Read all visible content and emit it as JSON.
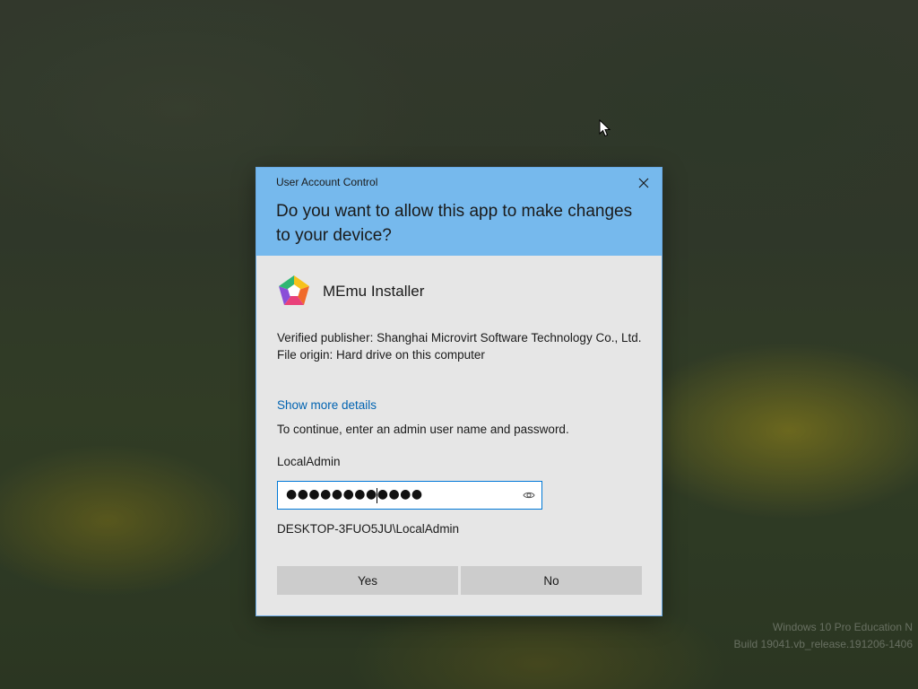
{
  "desktop": {
    "watermark_line1": "Windows 10 Pro Education N",
    "watermark_line2": "Build 19041.vb_release.191206-1406"
  },
  "uac": {
    "caption": "User Account Control",
    "question": "Do you want to allow this app to make changes to your device?",
    "app_name": "MEmu Installer",
    "publisher_text": "Verified publisher: Shanghai Microvirt Software Technology Co., Ltd.",
    "origin_text": "File origin: Hard drive on this computer",
    "show_more_label": "Show more details",
    "continue_text": "To continue, enter an admin user name and password.",
    "username": "LocalAdmin",
    "password_masked": "●●●●●●●●●●●●",
    "domain_user": "DESKTOP-3FUO5JU\\LocalAdmin",
    "yes_label": "Yes",
    "no_label": "No"
  },
  "icons": {
    "close": "close-icon",
    "app": "memu-app-icon",
    "reveal": "eye-icon",
    "cursor": "mouse-cursor-icon"
  },
  "colors": {
    "header": "#76b9ed",
    "body": "#e6e6e6",
    "link": "#0063b1",
    "focus_border": "#0078d7",
    "button": "#cccccc"
  }
}
